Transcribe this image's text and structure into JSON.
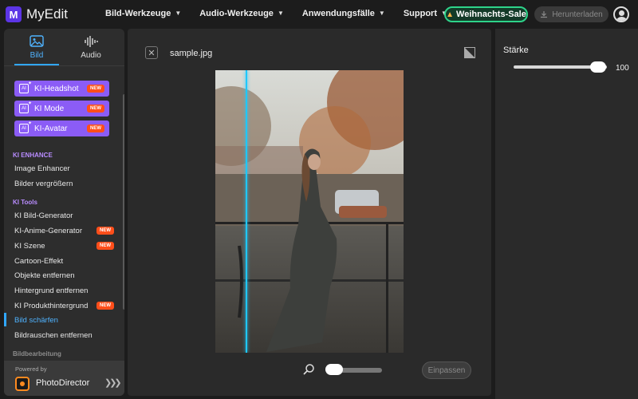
{
  "app": {
    "name": "MyEdit"
  },
  "nav": [
    {
      "label": "Bild-Werkzeuge"
    },
    {
      "label": "Audio-Werkzeuge"
    },
    {
      "label": "Anwendungsfälle"
    },
    {
      "label": "Support"
    }
  ],
  "header": {
    "sale_label": "Weihnachts-Sale",
    "download_label": "Herunterladen"
  },
  "sidebar": {
    "tabs": [
      {
        "label": "Bild"
      },
      {
        "label": "Audio"
      }
    ],
    "promo": [
      {
        "label": "KI-Headshot",
        "badge": "NEW"
      },
      {
        "label": "KI Mode",
        "badge": "NEW"
      },
      {
        "label": "KI-Avatar",
        "badge": "NEW"
      }
    ],
    "sections": [
      {
        "title": "KI ENHANCE",
        "items": [
          {
            "label": "Image Enhancer"
          },
          {
            "label": "Bilder vergrößern"
          }
        ]
      },
      {
        "title": "KI Tools",
        "items": [
          {
            "label": "KI Bild-Generator"
          },
          {
            "label": "KI-Anime-Generator",
            "badge": "NEW"
          },
          {
            "label": "KI Szene",
            "badge": "NEW"
          },
          {
            "label": "Cartoon-Effekt"
          },
          {
            "label": "Objekte entfernen"
          },
          {
            "label": "Hintergrund entfernen"
          },
          {
            "label": "KI Produkthintergrund",
            "badge": "NEW"
          },
          {
            "label": "Bild schärfen",
            "active": true
          },
          {
            "label": "Bildrauschen entfernen"
          }
        ]
      },
      {
        "title": "Bildbearbeitung",
        "items": []
      }
    ],
    "powered_by": "Powered by",
    "powered_brand": "PhotoDirector"
  },
  "canvas": {
    "filename": "sample.jpg",
    "fit_label": "Einpassen"
  },
  "panel": {
    "strength_label": "Stärke",
    "strength_value": "100"
  },
  "colors": {
    "accent": "#31a7ff",
    "promo": "#8b5cf6",
    "new_badge": "#ff4e1a",
    "sale_border": "#2ed38a"
  }
}
